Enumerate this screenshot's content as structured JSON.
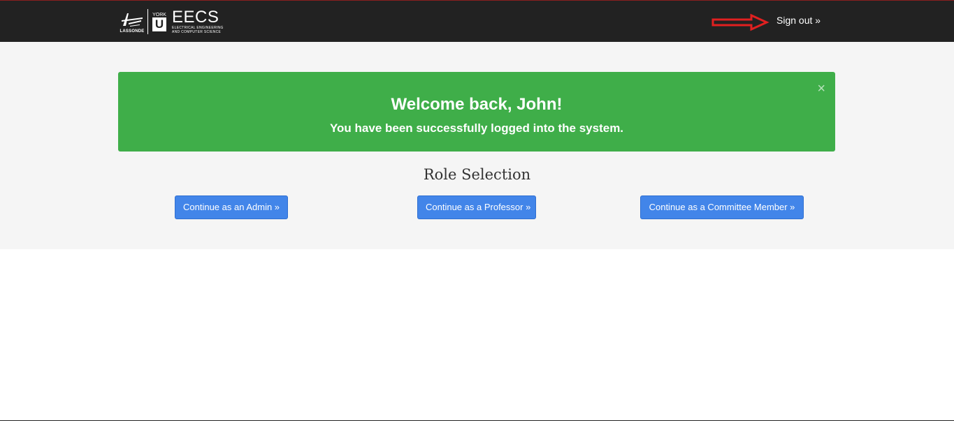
{
  "header": {
    "logo": {
      "lassonde_text": "LASSONDE",
      "york_text": "YORK",
      "york_letter": "U",
      "eecs_text": "EECS",
      "eecs_sub_line1": "ELECTRICAL ENGINEERING",
      "eecs_sub_line2": "AND COMPUTER SCIENCE"
    },
    "signout_label": "Sign out »"
  },
  "alert": {
    "title": "Welcome back, John!",
    "message": "You have been successfully logged into the system.",
    "close_glyph": "×",
    "color": "#3fae49"
  },
  "roles": {
    "title": "Role Selection",
    "buttons": [
      {
        "label": "Continue as an Admin »"
      },
      {
        "label": "Continue as a Professor »"
      },
      {
        "label": "Continue as a Committee Member »"
      }
    ]
  },
  "colors": {
    "topbar": "#222222",
    "button": "#4285e9",
    "annotation_arrow": "#e02020"
  }
}
